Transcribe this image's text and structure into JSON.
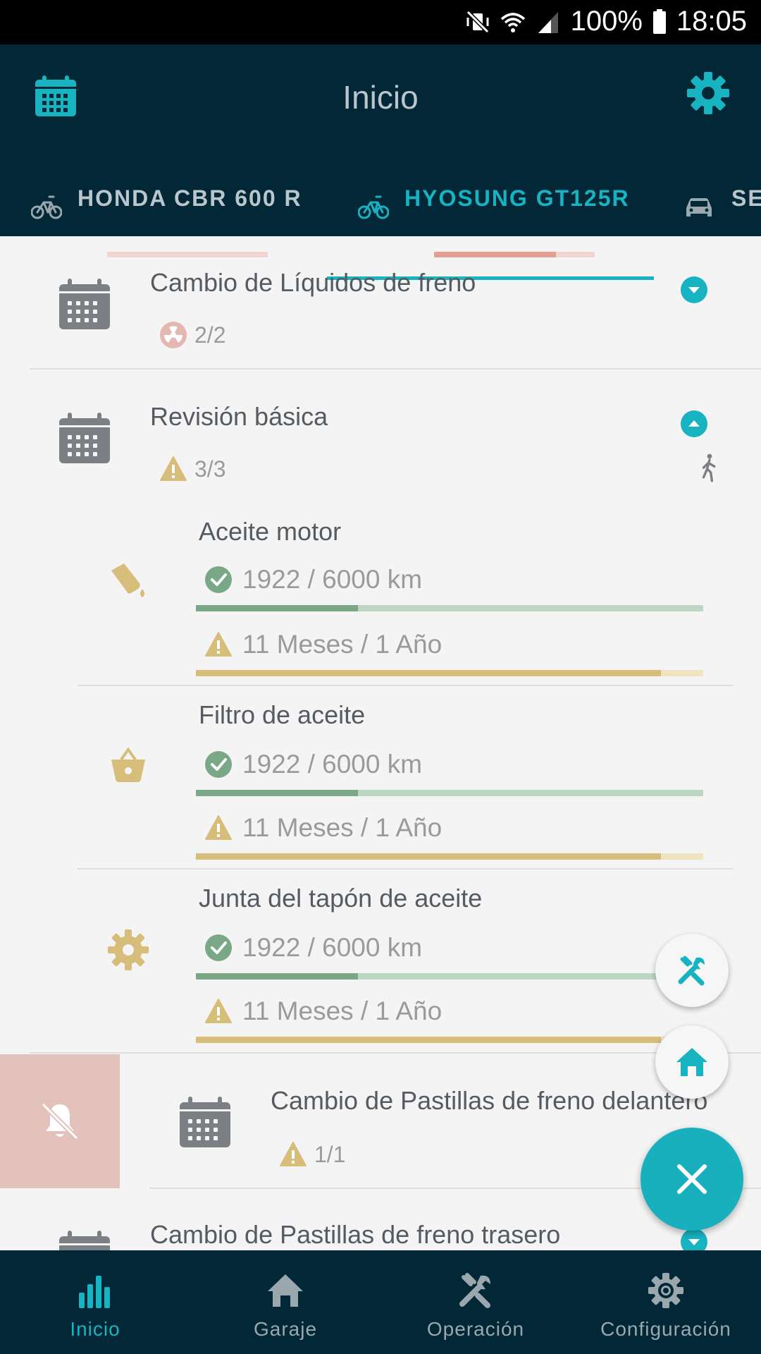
{
  "status_bar": {
    "battery": "100%",
    "time": "18:05"
  },
  "app_bar": {
    "title": "Inicio"
  },
  "vehicle_tabs": [
    {
      "label": "HONDA CBR 600 R",
      "progress": 1.0
    },
    {
      "label": "HYOSUNG GT125R",
      "progress": 0.76
    },
    {
      "label": "SE"
    }
  ],
  "maintenance": {
    "groups": [
      {
        "title": "Cambio de Líquidos de freno",
        "badge": "2/2"
      },
      {
        "title": "Revisión básica",
        "badge": "3/3",
        "items": [
          {
            "name": "Aceite motor",
            "km": "1922 / 6000 km",
            "km_progress": 0.32,
            "time": "11 Meses / 1 Año",
            "time_progress": 0.917
          },
          {
            "name": "Filtro de aceite",
            "km": "1922 / 6000 km",
            "km_progress": 0.32,
            "time": "11 Meses / 1 Año",
            "time_progress": 0.917
          },
          {
            "name": "Junta del tapón de aceite",
            "km": "1922 / 6000 km",
            "km_progress": 0.32,
            "time": "11 Meses / 1 Año",
            "time_progress": 0.917
          }
        ]
      },
      {
        "title": "Cambio de Pastillas de freno delantero",
        "badge": "1/1"
      },
      {
        "title": "Cambio de Pastillas de freno trasero"
      }
    ]
  },
  "bottom_nav": [
    {
      "label": "Inicio"
    },
    {
      "label": "Garaje"
    },
    {
      "label": "Operación"
    },
    {
      "label": "Configuración"
    }
  ],
  "colors": {
    "accent": "#17b3c1",
    "header": "#022838",
    "ok_green": "#7aa886",
    "warn_yellow": "#d6bd79",
    "alert_red": "#e39f92"
  }
}
